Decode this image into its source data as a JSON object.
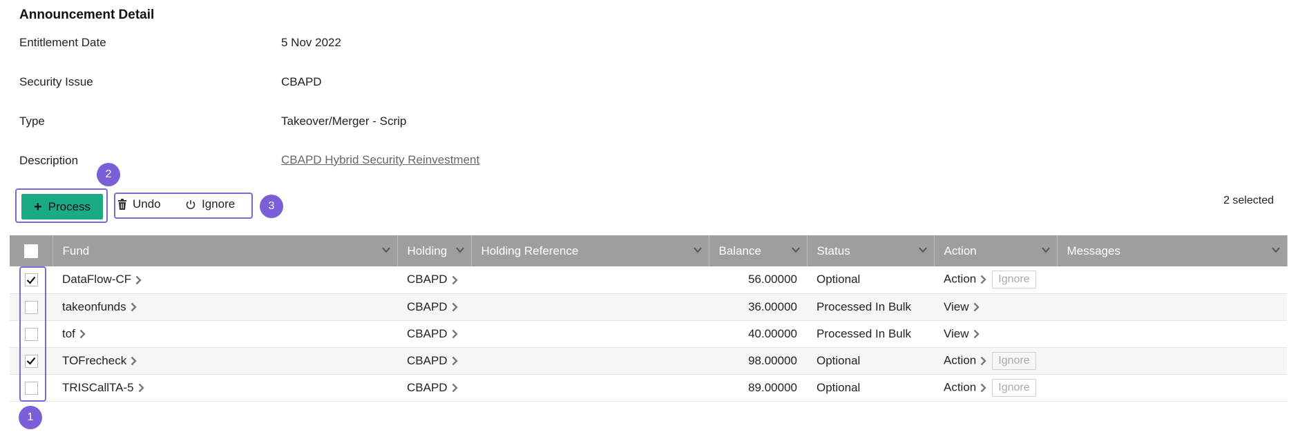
{
  "page": {
    "title": "Announcement Detail"
  },
  "details": [
    {
      "label": "Entitlement Date",
      "value": "5 Nov 2022"
    },
    {
      "label": "Security Issue",
      "value": "CBAPD"
    },
    {
      "label": "Type",
      "value": "Takeover/Merger - Scrip"
    },
    {
      "label": "Description",
      "value": "CBAPD Hybrid Security Reinvestment"
    }
  ],
  "toolbar": {
    "process_label": "Process",
    "undo_label": "Undo",
    "ignore_label": "Ignore",
    "selected_text": "2 selected"
  },
  "markers": [
    "1",
    "2",
    "3"
  ],
  "table": {
    "columns": [
      "Fund",
      "Holding",
      "Holding Reference",
      "Balance",
      "Status",
      "Action",
      "Messages"
    ],
    "rows": [
      {
        "checked": true,
        "fund": "DataFlow-CF",
        "holding": "CBAPD",
        "holding_reference": "",
        "balance": "56.00000",
        "status": "Optional",
        "action": "Action",
        "ignore": "Ignore",
        "messages": ""
      },
      {
        "checked": false,
        "fund": "takeonfunds",
        "holding": "CBAPD",
        "holding_reference": "",
        "balance": "36.00000",
        "status": "Processed In Bulk",
        "action": "View",
        "ignore": "",
        "messages": ""
      },
      {
        "checked": false,
        "fund": "tof",
        "holding": "CBAPD",
        "holding_reference": "",
        "balance": "40.00000",
        "status": "Processed In Bulk",
        "action": "View",
        "ignore": "",
        "messages": ""
      },
      {
        "checked": true,
        "fund": "TOFrecheck",
        "holding": "CBAPD",
        "holding_reference": "",
        "balance": "98.00000",
        "status": "Optional",
        "action": "Action",
        "ignore": "Ignore",
        "messages": ""
      },
      {
        "checked": false,
        "fund": "TRISCallTA-5",
        "holding": "CBAPD",
        "holding_reference": "",
        "balance": "89.00000",
        "status": "Optional",
        "action": "Action",
        "ignore": "Ignore",
        "messages": ""
      }
    ]
  },
  "colors": {
    "accent": "#1aaa85",
    "annotation": "#7b5fd6",
    "header_bg": "#9e9e9e",
    "status_bulk": "#22a622",
    "status_optional": "#8a8a8a"
  },
  "icons": [
    "plus-icon",
    "trash-icon",
    "power-icon",
    "chevron-down-icon",
    "chevron-right-icon",
    "check-icon"
  ]
}
